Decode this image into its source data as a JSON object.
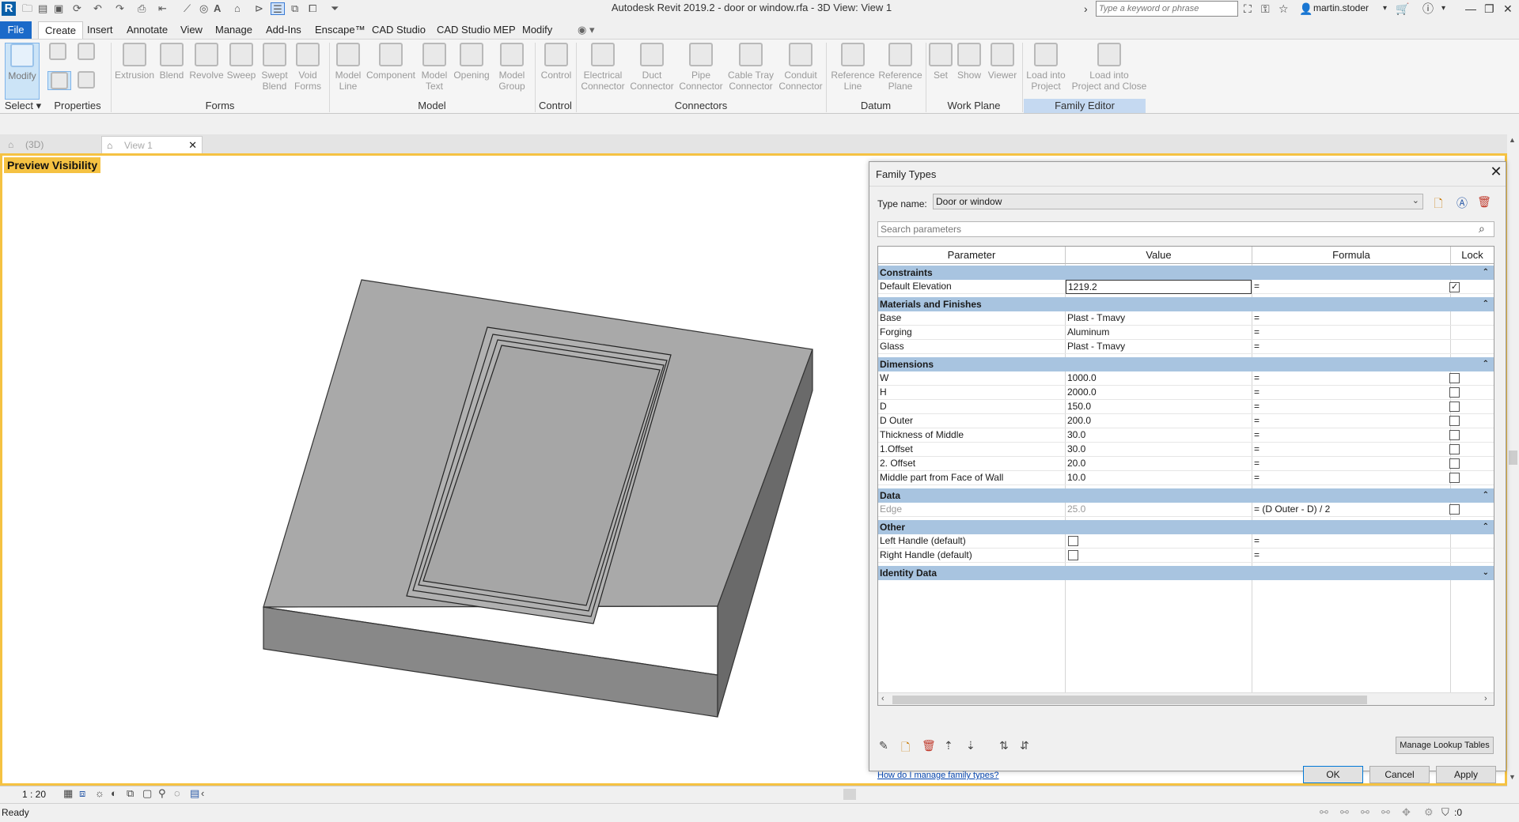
{
  "window": {
    "title": "Autodesk Revit 2019.2 - door or window.rfa - 3D View: View 1",
    "search_placeholder": "Type a keyword or phrase",
    "user": "martin.stoder",
    "app_logo": "R"
  },
  "tabs": [
    "File",
    "Create",
    "Insert",
    "Annotate",
    "View",
    "Manage",
    "Add-Ins",
    "Enscape™",
    "CAD Studio",
    "CAD Studio MEP",
    "Modify"
  ],
  "ribbon": {
    "buttons": [
      {
        "label": "Modify"
      },
      {
        "label": "Extrusion"
      },
      {
        "label": "Blend"
      },
      {
        "label": "Revolve"
      },
      {
        "label": "Sweep"
      },
      {
        "label": "Swept\nBlend"
      },
      {
        "label": "Void\nForms"
      },
      {
        "label": "Model\nLine"
      },
      {
        "label": "Component"
      },
      {
        "label": "Model\nText"
      },
      {
        "label": "Opening"
      },
      {
        "label": "Model\nGroup"
      },
      {
        "label": "Control"
      },
      {
        "label": "Electrical\nConnector"
      },
      {
        "label": "Duct\nConnector"
      },
      {
        "label": "Pipe\nConnector"
      },
      {
        "label": "Cable Tray\nConnector"
      },
      {
        "label": "Conduit\nConnector"
      },
      {
        "label": "Reference\nLine"
      },
      {
        "label": "Reference\nPlane"
      },
      {
        "label": "Set"
      },
      {
        "label": "Show"
      },
      {
        "label": "Viewer"
      },
      {
        "label": "Load into\nProject"
      },
      {
        "label": "Load into\nProject and Close"
      }
    ],
    "panels": [
      "Select",
      "Properties",
      "Forms",
      "Model",
      "Control",
      "Connectors",
      "Datum",
      "Work Plane",
      "Family Editor"
    ]
  },
  "view_tabs": [
    "(3D)",
    "View 1"
  ],
  "preview_label": "Preview Visibility",
  "dialog": {
    "title": "Family Types",
    "type_name_label": "Type name:",
    "type_name_value": "Door or window",
    "search_placeholder": "Search parameters",
    "headers": [
      "Parameter",
      "Value",
      "Formula",
      "Lock"
    ],
    "groups": [
      {
        "name": "Constraints",
        "rows": [
          {
            "param": "Default Elevation",
            "value": "1219.2",
            "formula": "=",
            "lock": true,
            "editing": true
          }
        ]
      },
      {
        "name": "Materials and Finishes",
        "rows": [
          {
            "param": "Base",
            "value": "Plast - Tmavy",
            "formula": "="
          },
          {
            "param": "Forging",
            "value": "Aluminum",
            "formula": "="
          },
          {
            "param": "Glass",
            "value": "Plast - Tmavy",
            "formula": "="
          }
        ]
      },
      {
        "name": "Dimensions",
        "rows": [
          {
            "param": "W",
            "value": "1000.0",
            "formula": "=",
            "lock": false
          },
          {
            "param": "H",
            "value": "2000.0",
            "formula": "=",
            "lock": false
          },
          {
            "param": "D",
            "value": "150.0",
            "formula": "=",
            "lock": false
          },
          {
            "param": "D Outer",
            "value": "200.0",
            "formula": "=",
            "lock": false
          },
          {
            "param": "Thickness of Middle",
            "value": "30.0",
            "formula": "=",
            "lock": false
          },
          {
            "param": "1.Offset",
            "value": "30.0",
            "formula": "=",
            "lock": false
          },
          {
            "param": "2. Offset",
            "value": "20.0",
            "formula": "=",
            "lock": false
          },
          {
            "param": "Middle part from Face of Wall",
            "value": "10.0",
            "formula": "=",
            "lock": false
          }
        ]
      },
      {
        "name": "Data",
        "rows": [
          {
            "param": "Edge",
            "value": "25.0",
            "formula": "= (D Outer - D) / 2",
            "lock": false,
            "dim": true
          }
        ]
      },
      {
        "name": "Other",
        "rows": [
          {
            "param": "Left Handle (default)",
            "value_check": false,
            "formula": "="
          },
          {
            "param": "Right Handle (default)",
            "value_check": false,
            "formula": "="
          }
        ]
      },
      {
        "name": "Identity Data",
        "rows": [],
        "collapsed": true
      }
    ],
    "manage_lookup": "Manage Lookup Tables",
    "help_link": "How do I manage family types?",
    "ok": "OK",
    "cancel": "Cancel",
    "apply": "Apply"
  },
  "view_control": {
    "scale": "1 : 20"
  },
  "status": {
    "text": "Ready",
    "filter_count": ":0"
  },
  "colors": {
    "accent": "#1b6ac9",
    "highlight": "#f5c242",
    "group_header": "#a8c4e0"
  }
}
